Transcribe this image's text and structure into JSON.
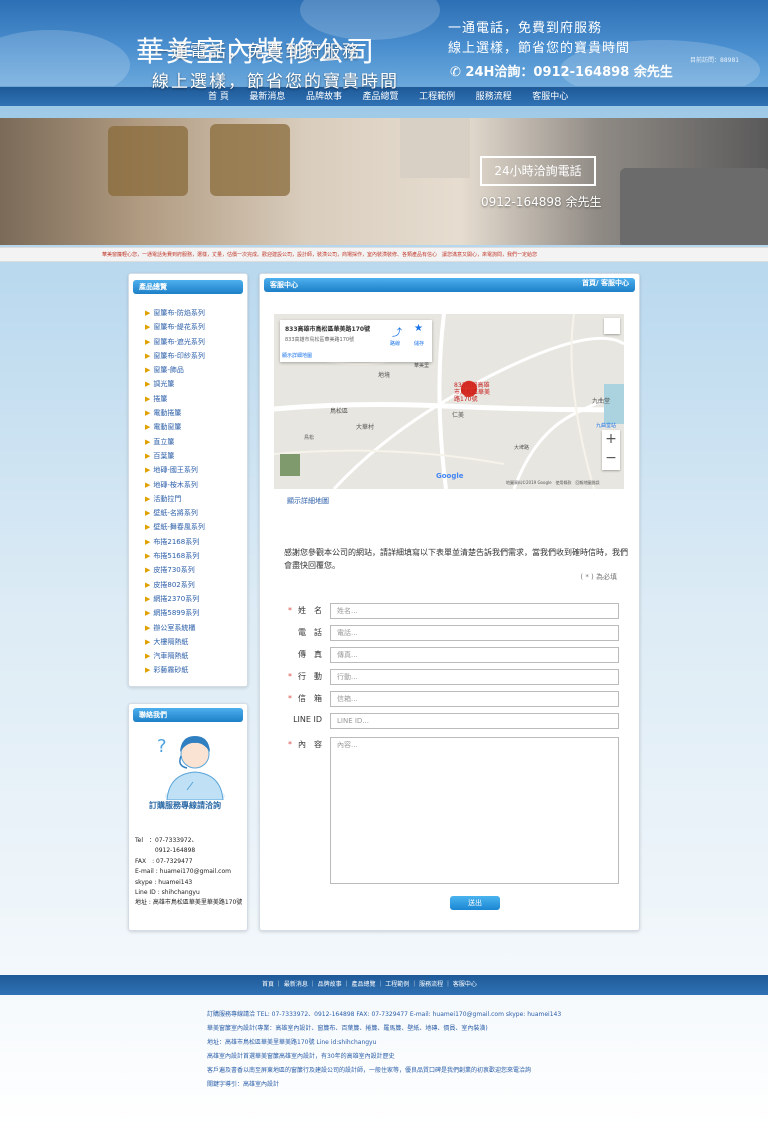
{
  "header": {
    "logo": "華美室內裝修公司",
    "slogan_line1": "一通電話，免費到府服務",
    "slogan_line2": "線上選樣，節省您的寶貴時間",
    "hotline": "24H洽詢：0912-164898 余先生",
    "visits": "目前訪問：88981"
  },
  "nav": [
    "首 頁",
    "最新消息",
    "品牌故事",
    "產品總覽",
    "工程範例",
    "服務流程",
    "客服中心"
  ],
  "banner": {
    "tagline1": "一通電話，免費到府服務",
    "tagline2": "線上選樣，節省您的寶貴時間",
    "box": "24小時洽詢電話",
    "phone": "0912-164898 余先生",
    "marquee": "華美窗簾輕心您，一通電話免費到府服務，選樣，丈量，估價一次完成。歡迎建設公司，設計師，裝潢公司，商場採作，室內裝潢裝修、各類產品有信心　讓您滿意又開心，來電詢問，我們一定給您"
  },
  "sidebar": {
    "products_title": "產品總覽",
    "products": [
      "窗簾布-防焰系列",
      "窗簾布-緹花系列",
      "窗簾布-遮光系列",
      "窗簾布-印紗系列",
      "窗簾-飾品",
      "調光簾",
      "捲簾",
      "電動捲簾",
      "電動窗簾",
      "直立簾",
      "百葉簾",
      "地磚-國王系列",
      "地磚-桉木系列",
      "活動拉門",
      "壁紙-名將系列",
      "壁紙-舞春風系列",
      "布捲2168系列",
      "布捲5168系列",
      "皮捲730系列",
      "皮捲802系列",
      "網捲2370系列",
      "網捲5899系列",
      "辦公室系統櫃",
      "大樓隔熱紙",
      "汽車隔熱紙",
      "彩藝霧砂紙"
    ],
    "contact_title": "聯絡我們",
    "contact_cta": "訂購服務專線請洽詢",
    "contact_lines": [
      "Tel　：07-7333972、",
      "　　　 0912-164898",
      "FAX　: 07-7329477",
      "E-mail : huamei170@gmail.com",
      "skype : huamei143",
      "Line ID : shihchangyu",
      "地址 : 高雄市鳥松區華美里華美路170號"
    ]
  },
  "main": {
    "title": "客服中心",
    "breadcrumb": "首頁/ 客服中心",
    "map": {
      "card_title": "833高雄市鳥松區華美路170號",
      "card_sub": "833高雄市鳥松區華美路170號",
      "directions": "路線",
      "save": "儲存",
      "larger_map": "顯示詳細地圖",
      "pin_label": "833台灣高雄市鳥松區華美路170號",
      "labels": [
        "地境",
        "鳥松區",
        "仁美",
        "大華村",
        "九曲堂",
        "九曲堂站",
        "華美里",
        "鳥松",
        "大埤路"
      ],
      "google": "Google",
      "copyright": "地圖資料©2019 Google　使用條款　回報地圖錯誤"
    },
    "show_map": "顯示詳細地圖",
    "intro": "感謝您參觀本公司的網站，請詳細填寫以下表單並清楚告訴我們需求，當我們收到確時信時，我們會盡快回覆您。",
    "required_note": "( * ) 為必填",
    "form": [
      {
        "label": "姓　名",
        "required": true,
        "placeholder": "姓名..."
      },
      {
        "label": "電　話",
        "required": false,
        "placeholder": "電話..."
      },
      {
        "label": "傳　真",
        "required": false,
        "placeholder": "傳真..."
      },
      {
        "label": "行　動",
        "required": true,
        "placeholder": "行動..."
      },
      {
        "label": "信　箱",
        "required": true,
        "placeholder": "信箱..."
      },
      {
        "label": "LINE ID",
        "required": false,
        "placeholder": "LINE ID..."
      },
      {
        "label": "內　容",
        "required": true,
        "placeholder": "內容..."
      }
    ],
    "submit": "送出"
  },
  "footer": {
    "nav": "首頁 ｜ 最新消息 ｜ 品牌故事 ｜ 產品總覽 ｜ 工程範例 ｜ 服務流程 ｜ 客服中心",
    "lines": [
      "訂購服務專線請洽 TEL: 07-7333972、0912-164898 FAX: 07-7329477   E-mail: huamei170@gmail.com   skype: huamei143",
      "華美窗簾室內設計(專業：高雄室內設計、窗簾布、百葉簾、捲簾、羅馬簾、壁紙、地磚、價員、室內裝潢)",
      "地址：高雄市鳥松區華美里華美路170號   Line id:shihchangyu",
      "高雄室內設計首選華美窗簾高雄室內設計，有30年的高雄室內設計歷史",
      "客戶遍及書香以南至屏東地區的窗簾行及建設公司的設計師，一般住家等，優良品質口碑是我們創業的初衷歡迎您來電洽詢",
      "關鍵字導引：高雄室內設計"
    ]
  }
}
